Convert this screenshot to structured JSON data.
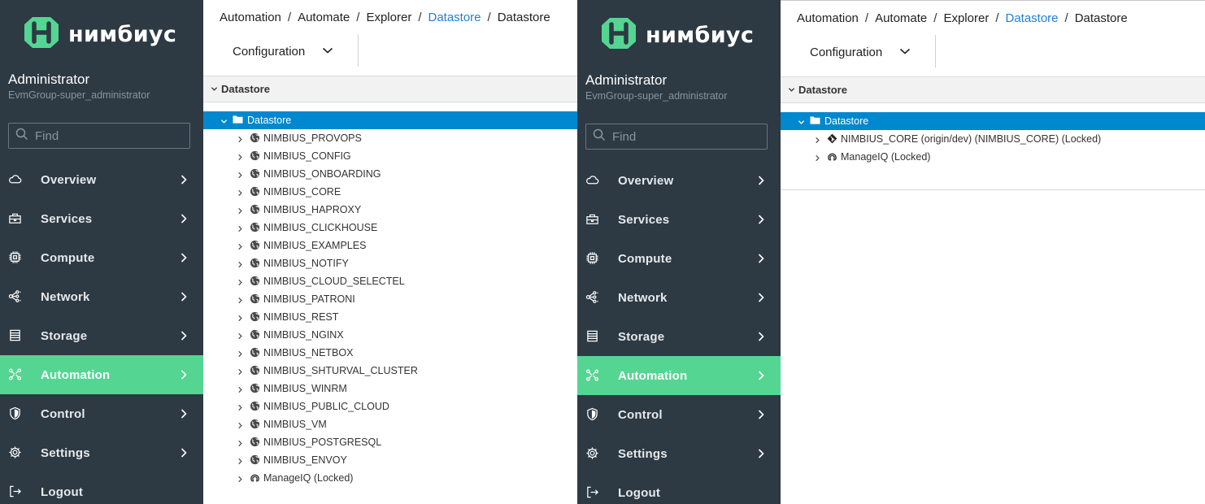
{
  "colors": {
    "sidebar_bg": "#2d3943",
    "active_nav": "#55d592",
    "selected_row": "#0088ce",
    "link": "#1f7fd6"
  },
  "brand": {
    "name": "нимбиус"
  },
  "user": {
    "name": "Administrator",
    "group": "EvmGroup-super_administrator"
  },
  "search": {
    "placeholder": "Find"
  },
  "nav": [
    {
      "label": "Overview",
      "icon": "cloud-icon"
    },
    {
      "label": "Services",
      "icon": "services-icon"
    },
    {
      "label": "Compute",
      "icon": "chip-icon"
    },
    {
      "label": "Network",
      "icon": "network-icon"
    },
    {
      "label": "Storage",
      "icon": "storage-icon"
    },
    {
      "label": "Automation",
      "icon": "automation-icon",
      "active": true
    },
    {
      "label": "Control",
      "icon": "shield-icon"
    },
    {
      "label": "Settings",
      "icon": "gear-icon"
    },
    {
      "label": "Logout",
      "icon": "logout-icon"
    }
  ],
  "left": {
    "breadcrumb": [
      "Automation",
      "Automate",
      "Explorer",
      "Datastore",
      "Datastore"
    ],
    "toolbar": {
      "configuration": "Configuration"
    },
    "section_title": "Datastore",
    "tree_root": "Datastore",
    "tree_items": [
      {
        "label": "NIMBIUS_PROVOPS",
        "icon": "globe-icon"
      },
      {
        "label": "NIMBIUS_CONFIG",
        "icon": "globe-icon"
      },
      {
        "label": "NIMBIUS_ONBOARDING",
        "icon": "globe-icon"
      },
      {
        "label": "NIMBIUS_CORE",
        "icon": "globe-icon"
      },
      {
        "label": "NIMBIUS_HAPROXY",
        "icon": "globe-icon"
      },
      {
        "label": "NIMBIUS_CLICKHOUSE",
        "icon": "globe-icon"
      },
      {
        "label": "NIMBIUS_EXAMPLES",
        "icon": "globe-icon"
      },
      {
        "label": "NIMBIUS_NOTIFY",
        "icon": "globe-icon"
      },
      {
        "label": "NIMBIUS_CLOUD_SELECTEL",
        "icon": "globe-icon"
      },
      {
        "label": "NIMBIUS_PATRONI",
        "icon": "globe-icon"
      },
      {
        "label": "NIMBIUS_REST",
        "icon": "globe-icon"
      },
      {
        "label": "NIMBIUS_NGINX",
        "icon": "globe-icon"
      },
      {
        "label": "NIMBIUS_NETBOX",
        "icon": "globe-icon"
      },
      {
        "label": "NIMBIUS_SHTURVAL_CLUSTER",
        "icon": "globe-icon"
      },
      {
        "label": "NIMBIUS_WINRM",
        "icon": "globe-icon"
      },
      {
        "label": "NIMBIUS_PUBLIC_CLOUD",
        "icon": "globe-icon"
      },
      {
        "label": "NIMBIUS_VM",
        "icon": "globe-icon"
      },
      {
        "label": "NIMBIUS_POSTGRESQL",
        "icon": "globe-icon"
      },
      {
        "label": "NIMBIUS_ENVOY",
        "icon": "globe-icon"
      },
      {
        "label": "ManageIQ (Locked)",
        "icon": "manageiq-icon"
      }
    ]
  },
  "right": {
    "breadcrumb": [
      "Automation",
      "Automate",
      "Explorer",
      "Datastore",
      "Datastore"
    ],
    "toolbar": {
      "configuration": "Configuration"
    },
    "section_title": "Datastore",
    "tree_root": "Datastore",
    "tree_items": [
      {
        "label": "NIMBIUS_CORE (origin/dev) (NIMBIUS_CORE) (Locked)",
        "icon": "git-icon"
      },
      {
        "label": "ManageIQ (Locked)",
        "icon": "manageiq-icon"
      }
    ]
  }
}
